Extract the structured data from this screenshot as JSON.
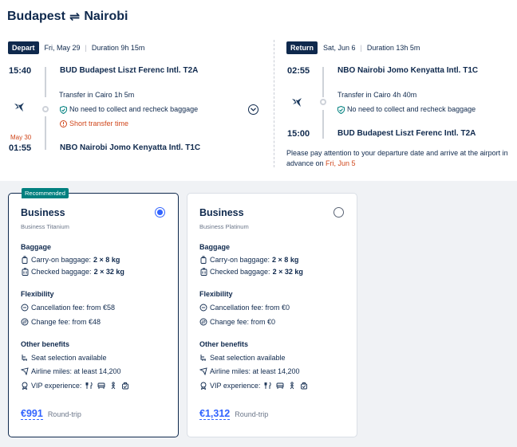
{
  "header": {
    "origin": "Budapest",
    "destination": "Nairobi",
    "swap_icon": "⇌"
  },
  "depart": {
    "tag": "Depart",
    "date": "Fri, May 29",
    "duration": "Duration 9h 15m",
    "dep_time": "15:40",
    "dep_airport": "BUD Budapest Liszt Ferenc Intl. T2A",
    "transfer": "Transfer in Cairo  1h 5m",
    "baggage_note": "No need to collect and recheck baggage",
    "warning": "Short transfer time",
    "arr_nextday": "May 30",
    "arr_time": "01:55",
    "arr_airport": "NBO Nairobi Jomo Kenyatta Intl. T1C"
  },
  "return": {
    "tag": "Return",
    "date": "Sat, Jun 6",
    "duration": "Duration 13h 5m",
    "dep_time": "02:55",
    "dep_airport": "NBO Nairobi Jomo Kenyatta Intl. T1C",
    "transfer": "Transfer in Cairo  4h 40m",
    "baggage_note": "No need to collect and recheck baggage",
    "arr_time": "15:00",
    "arr_airport": "BUD Budapest Liszt Ferenc Intl. T2A",
    "notice_pre": "Please pay attention to your departure date and arrive at the airport in advance on ",
    "notice_date": "Fri, Jun 5"
  },
  "fares": [
    {
      "badge": "Recommended",
      "name": "Business",
      "subname": "Business Titanium",
      "selected": true,
      "baggage_title": "Baggage",
      "carry_label": "Carry-on baggage:",
      "carry_value": "2 × 8 kg",
      "checked_label": "Checked baggage:",
      "checked_value": "2 × 32 kg",
      "flex_title": "Flexibility",
      "cancel": "Cancellation fee: from €58",
      "change": "Change fee: from €48",
      "other_title": "Other benefits",
      "seat": "Seat selection available",
      "miles": "Airline miles: at least 14,200",
      "vip": "VIP experience:",
      "price": "€991",
      "price_note": "Round-trip"
    },
    {
      "badge": "",
      "name": "Business",
      "subname": "Business Platinum",
      "selected": false,
      "baggage_title": "Baggage",
      "carry_label": "Carry-on baggage:",
      "carry_value": "2 × 8 kg",
      "checked_label": "Checked baggage:",
      "checked_value": "2 × 32 kg",
      "flex_title": "Flexibility",
      "cancel": "Cancellation fee: from €0",
      "change": "Change fee: from €0",
      "other_title": "Other benefits",
      "seat": "Seat selection available",
      "miles": "Airline miles: at least 14,200",
      "vip": "VIP experience:",
      "price": "€1,312",
      "price_note": "Round-trip"
    }
  ],
  "colors": {
    "navy": "#0f294d",
    "accent_blue": "#3264ff",
    "warning": "#d0471c",
    "recommended_bg": "#00807f",
    "panel_bg": "#f0f2f5"
  }
}
